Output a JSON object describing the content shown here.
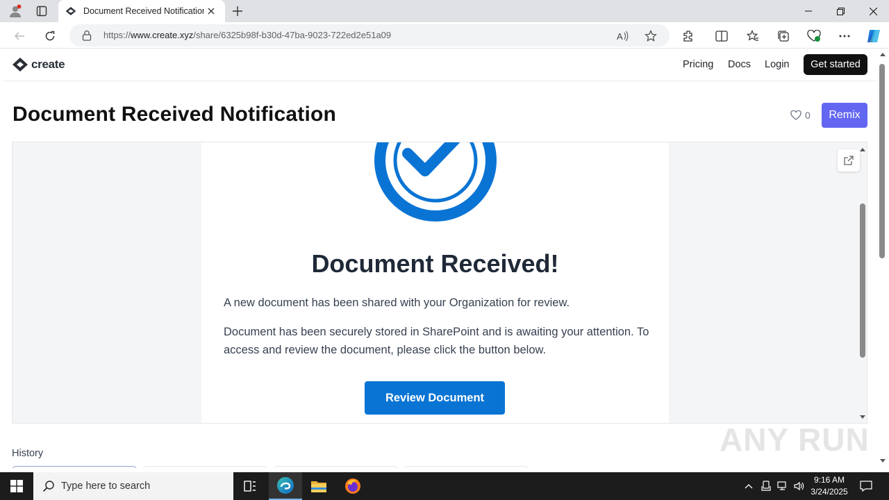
{
  "browser": {
    "tab_title": "Document Received Notification",
    "url_prefix": "https://",
    "url_host": "www.create.xyz",
    "url_path": "/share/6325b98f-b30d-47ba-9023-722ed2e51a09"
  },
  "site": {
    "logo_text": "create",
    "nav": {
      "pricing": "Pricing",
      "docs": "Docs",
      "login": "Login"
    },
    "cta_label": "Get started",
    "page_title": "Document Received Notification",
    "like_count": "0",
    "remix_label": "Remix",
    "history_label": "History"
  },
  "preview": {
    "heading": "Document Received!",
    "paragraph_1": "A new document has been shared with your Organization for review.",
    "paragraph_2": "Document has been securely stored in SharePoint and is awaiting your attention. To access and review the document, please click the button below.",
    "button_label": "Review Document",
    "accent_color": "#0a74d4"
  },
  "watermark": "ANY RUN",
  "taskbar": {
    "search_placeholder": "Type here to search",
    "time": "9:16 AM",
    "date": "3/24/2025"
  }
}
